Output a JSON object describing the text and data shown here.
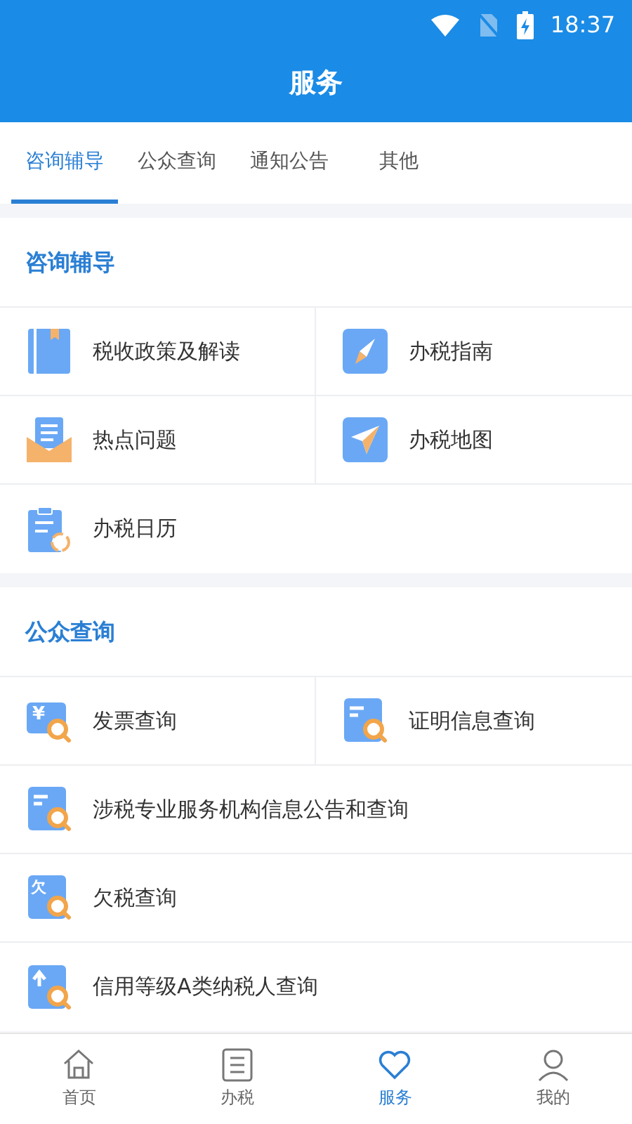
{
  "status_bar": {
    "time": "18:37"
  },
  "header": {
    "title": "服务"
  },
  "tabs": [
    {
      "label": "咨询辅导",
      "selected": true
    },
    {
      "label": "公众查询",
      "selected": false
    },
    {
      "label": "通知公告",
      "selected": false
    },
    {
      "label": "其他",
      "selected": false
    }
  ],
  "sections": [
    {
      "title": "咨询辅导",
      "items": [
        {
          "label": "税收政策及解读",
          "kind": "half"
        },
        {
          "label": "办税指南",
          "kind": "half"
        },
        {
          "label": "热点问题",
          "kind": "half"
        },
        {
          "label": "办税地图",
          "kind": "half"
        },
        {
          "label": "办税日历",
          "kind": "full"
        }
      ]
    },
    {
      "title": "公众查询",
      "items": [
        {
          "label": "发票查询",
          "kind": "half",
          "glyph": "¥"
        },
        {
          "label": "证明信息查询",
          "kind": "half"
        },
        {
          "label": "涉税专业服务机构信息公告和查询",
          "kind": "full"
        },
        {
          "label": "欠税查询",
          "kind": "full",
          "glyph": "欠"
        },
        {
          "label": "信用等级A类纳税人查询",
          "kind": "full"
        }
      ]
    }
  ],
  "bottom_nav": [
    {
      "label": "首页",
      "selected": false
    },
    {
      "label": "办税",
      "selected": false
    },
    {
      "label": "服务",
      "selected": true
    },
    {
      "label": "我的",
      "selected": false
    }
  ]
}
